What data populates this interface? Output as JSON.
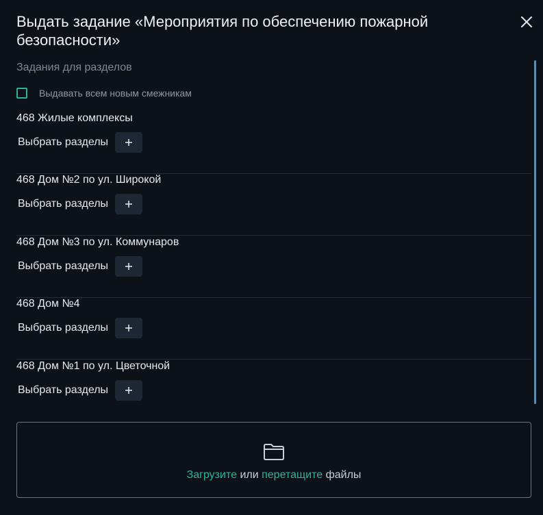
{
  "modal": {
    "title": "Выдать задание «Мероприятия по обеспечению пожарной безопасности»",
    "section_caption": "Задания для разделов",
    "checkbox_label": "Выдавать всем новым смежникам",
    "checkbox_checked": false,
    "select_sections_label": "Выбрать разделы",
    "add_symbol": "+",
    "close_icon": "close-icon"
  },
  "projects": [
    {
      "name": "468 Жилые комплексы"
    },
    {
      "name": "468 Дом №2 по ул. Широкой"
    },
    {
      "name": "468 Дом №3 по ул. Коммунаров"
    },
    {
      "name": "468 Дом №4"
    },
    {
      "name": "468 Дом №1 по ул. Цветочной"
    }
  ],
  "upload": {
    "upload_link": "Загрузите",
    "or_text": " или ",
    "drag_link": "перетащите",
    "files_text": " файлы",
    "icon": "folder-icon"
  },
  "colors": {
    "background": "#0d1219",
    "accent": "#2bb39a",
    "button_bg": "#1d2834",
    "scrollbar": "#5b8db0"
  }
}
